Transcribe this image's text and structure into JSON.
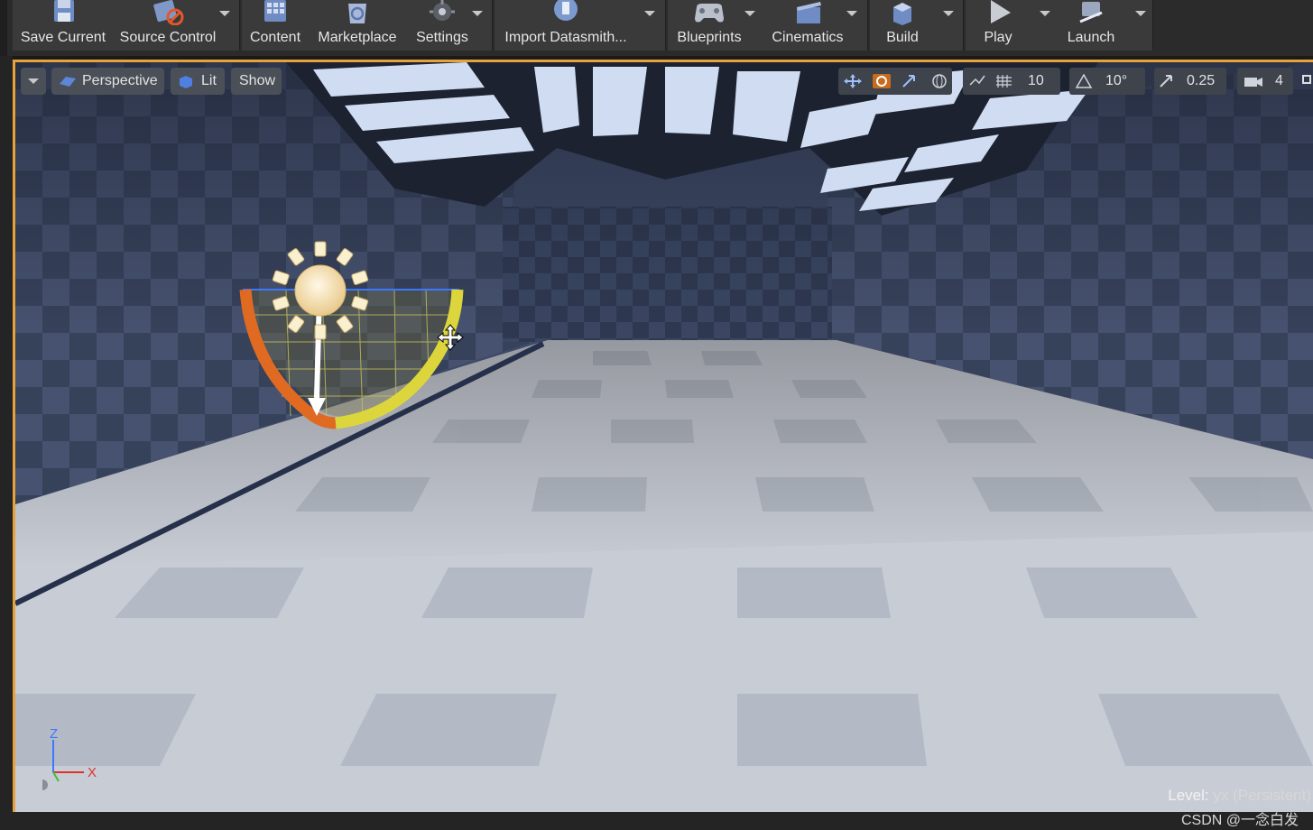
{
  "toolbar": {
    "buttons": [
      {
        "label": "Save Current",
        "icon": "save-icon"
      },
      {
        "label": "Source Control",
        "icon": "source-control-icon"
      },
      {
        "label": "Content",
        "icon": "content-icon"
      },
      {
        "label": "Marketplace",
        "icon": "marketplace-icon"
      },
      {
        "label": "Settings",
        "icon": "settings-icon"
      },
      {
        "label": "Import Datasmith...",
        "icon": "datasmith-icon"
      },
      {
        "label": "Blueprints",
        "icon": "blueprints-icon"
      },
      {
        "label": "Cinematics",
        "icon": "cinematics-icon"
      },
      {
        "label": "Build",
        "icon": "build-icon"
      },
      {
        "label": "Play",
        "icon": "play-icon"
      },
      {
        "label": "Launch",
        "icon": "launch-icon"
      }
    ]
  },
  "viewport": {
    "view_mode": "Perspective",
    "lighting_mode": "Lit",
    "show_label": "Show",
    "grid_snap_value": "10",
    "rotation_snap_value": "10°",
    "scale_snap_value": "0.25",
    "camera_speed_value": "4",
    "level_prefix": "Level:",
    "level_name": "yx (Persistent)",
    "axis": {
      "z": "Z",
      "x": "X"
    }
  },
  "watermark": "CSDN @一念白发",
  "colors": {
    "accent": "#e8a23a",
    "toolbar_bg": "#3a3a3a",
    "floor_light": "#c9cdd6",
    "wall": "#3e4a66"
  }
}
